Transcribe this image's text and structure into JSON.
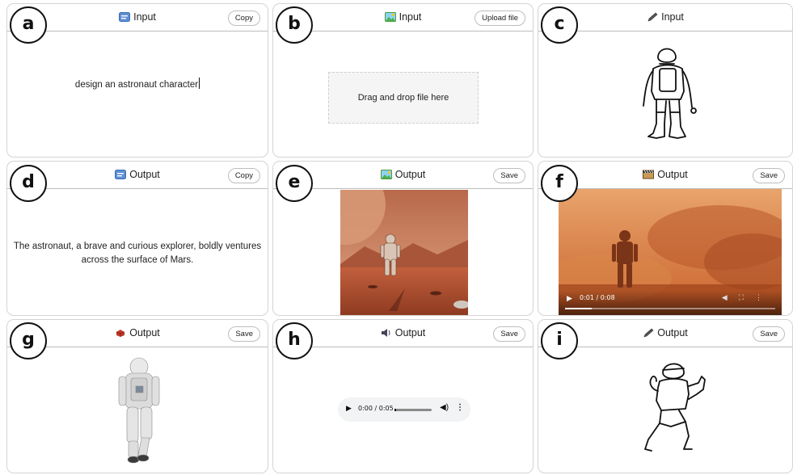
{
  "panels": {
    "a": {
      "badge": "a",
      "title": "Input",
      "icon": "text-input-icon",
      "button": "Copy",
      "text": "design an astronaut character"
    },
    "b": {
      "badge": "b",
      "title": "Input",
      "icon": "image-icon",
      "button": "Upload file",
      "dropzone": "Drag and drop file here"
    },
    "c": {
      "badge": "c",
      "title": "Input",
      "icon": "pencil-icon"
    },
    "d": {
      "badge": "d",
      "title": "Output",
      "icon": "text-output-icon",
      "button": "Copy",
      "text_line1": "The astronaut, a brave and curious explorer, boldly ventures",
      "text_line2": "across the surface of Mars."
    },
    "e": {
      "badge": "e",
      "title": "Output",
      "icon": "image-icon",
      "button": "Save"
    },
    "f": {
      "badge": "f",
      "title": "Output",
      "icon": "film-icon",
      "button": "Save",
      "video_time": "0:01 / 0:08",
      "video_progress": 0.125
    },
    "g": {
      "badge": "g",
      "title": "Output",
      "icon": "3d-object-icon",
      "button": "Save"
    },
    "h": {
      "badge": "h",
      "title": "Output",
      "icon": "speaker-icon",
      "button": "Save",
      "audio_time": "0:00 / 0:05",
      "audio_progress": 0.05
    },
    "i": {
      "badge": "i",
      "title": "Output",
      "icon": "pencil-icon",
      "button": "Save"
    }
  },
  "colors": {
    "border": "#d4d4d4",
    "header_line": "#bdbdbd",
    "mars_sky": "#c0744b",
    "mars_ground": "#a44a2c",
    "dust": "#e08a48",
    "audio_bg": "#f1f3f4"
  }
}
